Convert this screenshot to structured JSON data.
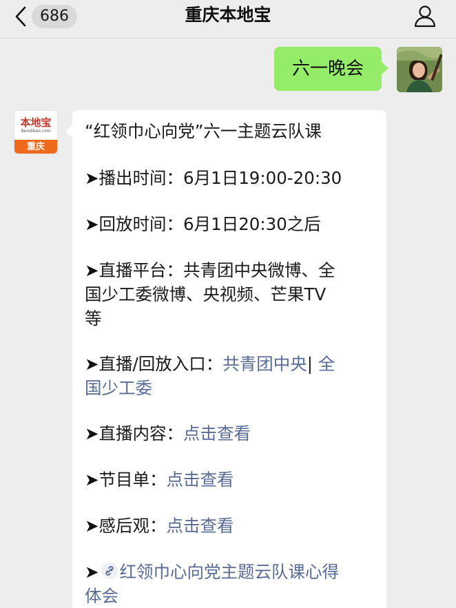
{
  "header": {
    "back_count": "686",
    "title": "重庆本地宝"
  },
  "outgoing": {
    "text": "六一晚会"
  },
  "sender": {
    "logo_text": "本地宝",
    "logo_domain": "Bendibao.com",
    "logo_city": "重庆"
  },
  "message": {
    "headline": "“红领巾心向党”六一主题云队课",
    "arrow": "➤",
    "broadcast_label": "播出时间：",
    "broadcast_value": "6月1日19:00-20:30",
    "replay_label": "回放时间：",
    "replay_value": "6月1日20:30之后",
    "platform_label": "直播平台：",
    "platform_value_line1": "共青团中央微博、全",
    "platform_value_line2": "国少工委微博、央视频、芒果TV",
    "platform_value_line3": "等",
    "entry_label": "直播/回放入口：",
    "entry_link1": "共青团中央",
    "entry_sep": "| ",
    "entry_link2_part1": "全",
    "entry_link2_part2": "国少工委",
    "content_label": "直播内容：",
    "content_link": "点击查看",
    "program_label": "节目单：",
    "program_link": "点击查看",
    "review_label": "感后观：",
    "review_link": "点击查看",
    "article_link_line1": "红领巾心向党主题云队课心得",
    "article_link_line2": "体会"
  },
  "colors": {
    "background": "#ededed",
    "outgoing_bubble": "#95ec69",
    "link": "#576b95",
    "logo_orange": "#f06a1b"
  }
}
